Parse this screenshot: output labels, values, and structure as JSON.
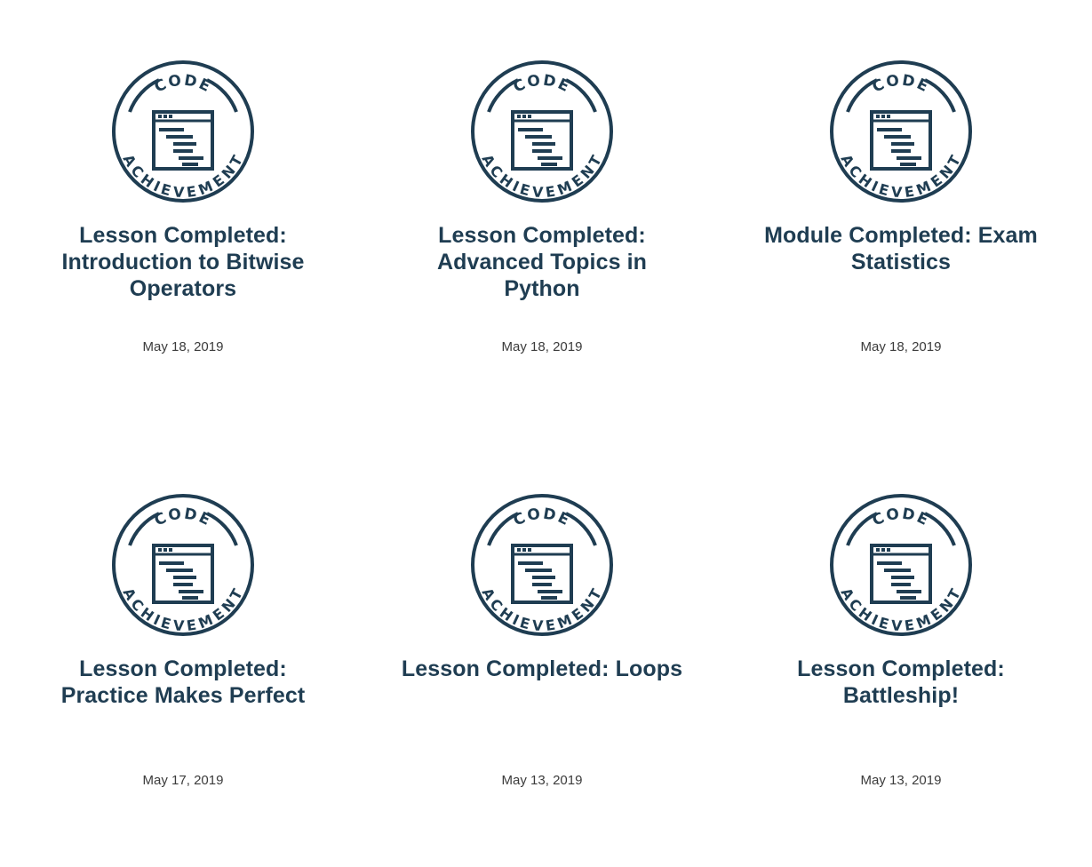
{
  "achievements": [
    {
      "badge": {
        "icon": "code-achievement-badge-icon",
        "top_text": "CODE",
        "bottom_text": "ACHIEVEMENT"
      },
      "title": "Lesson Completed: Introduction to Bitwise Operators",
      "date": "May 18, 2019"
    },
    {
      "badge": {
        "icon": "code-achievement-badge-icon",
        "top_text": "CODE",
        "bottom_text": "ACHIEVEMENT"
      },
      "title": "Lesson Completed: Advanced Topics in Python",
      "date": "May 18, 2019"
    },
    {
      "badge": {
        "icon": "code-achievement-badge-icon",
        "top_text": "CODE",
        "bottom_text": "ACHIEVEMENT"
      },
      "title": "Module Completed: Exam Statistics",
      "date": "May 18, 2019"
    },
    {
      "badge": {
        "icon": "code-achievement-badge-icon",
        "top_text": "CODE",
        "bottom_text": "ACHIEVEMENT"
      },
      "title": "Lesson Completed: Practice Makes Perfect",
      "date": "May 17, 2019"
    },
    {
      "badge": {
        "icon": "code-achievement-badge-icon",
        "top_text": "CODE",
        "bottom_text": "ACHIEVEMENT"
      },
      "title": "Lesson Completed: Loops",
      "date": "May 13, 2019"
    },
    {
      "badge": {
        "icon": "code-achievement-badge-icon",
        "top_text": "CODE",
        "bottom_text": "ACHIEVEMENT"
      },
      "title": "Lesson Completed: Battleship!",
      "date": "May 13, 2019"
    }
  ],
  "colors": {
    "badge": "#1f3d52",
    "title": "#1f3d52",
    "date": "#3b3b3b",
    "background": "#ffffff"
  }
}
